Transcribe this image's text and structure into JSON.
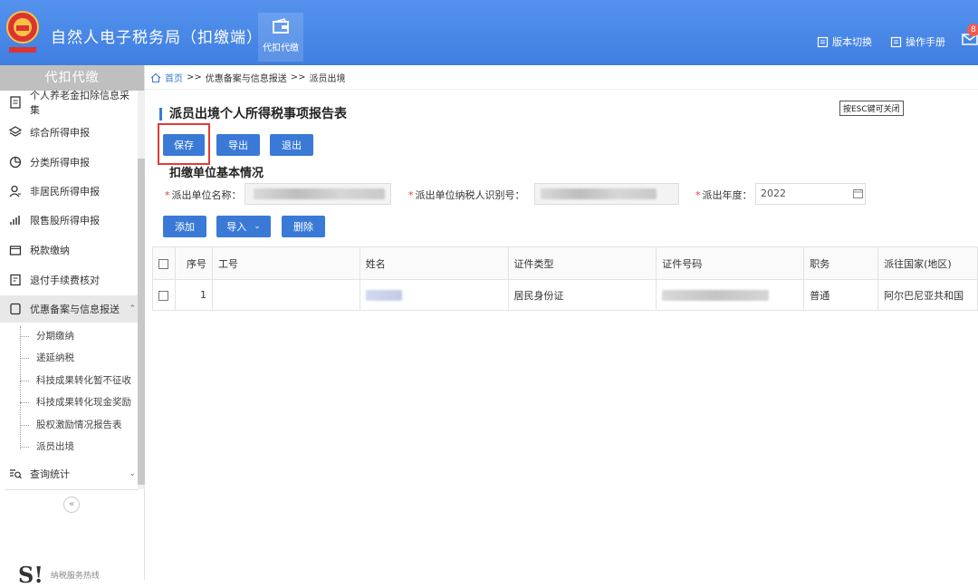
{
  "header": {
    "title": "自然人电子税务局（扣缴端）",
    "module_tab": "代扣代缴",
    "version_switch": "版本切换",
    "manual": "操作手册",
    "mail_badge": "8"
  },
  "sidebar": {
    "title": "代扣代缴",
    "items": [
      {
        "label": "个人养老金扣除信息采集",
        "icon": "document-icon"
      },
      {
        "label": "综合所得申报",
        "icon": "layers-icon"
      },
      {
        "label": "分类所得申报",
        "icon": "pie-icon"
      },
      {
        "label": "非居民所得申报",
        "icon": "person-icon"
      },
      {
        "label": "限售股所得申报",
        "icon": "bar-chart-icon"
      },
      {
        "label": "税款缴纳",
        "icon": "wallet-icon"
      },
      {
        "label": "退付手续费核对",
        "icon": "form-icon"
      },
      {
        "label": "优惠备案与信息报送",
        "icon": "file-icon"
      }
    ],
    "sub_items": [
      "分期缴纳",
      "递延纳税",
      "科技成果转化暂不征收",
      "科技成果转化现金奖励",
      "股权激励情况报告表",
      "派员出境"
    ],
    "query_item": "查询统计",
    "collapse": "«",
    "hotline": "纳税服务热线"
  },
  "breadcrumb": {
    "home": "首页",
    "sep": ">>",
    "level1": "优惠备案与信息报送",
    "level2": "派员出境"
  },
  "tooltip": "按ESC键可关闭",
  "form": {
    "title": "派员出境个人所得税事项报告表",
    "buttons": {
      "save": "保存",
      "export": "导出",
      "exit": "退出"
    },
    "section_title": "扣缴单位基本情况",
    "unit_name_label": "派出单位名称：",
    "tax_id_label": "派出单位纳税人识别号：",
    "year_label": "派出年度：",
    "year_value": "2022",
    "required_mark": "*"
  },
  "table_actions": {
    "add": "添加",
    "import": "导入",
    "delete": "删除"
  },
  "table": {
    "columns": [
      "序号",
      "工号",
      "姓名",
      "证件类型",
      "证件号码",
      "职务",
      "派往国家(地区)"
    ],
    "rows": [
      {
        "index": "1",
        "emp_no": "",
        "name": "",
        "id_type": "居民身份证",
        "id_number": "",
        "position": "普通",
        "country": "阿尔巴尼亚共和国"
      }
    ]
  },
  "colors": {
    "header": "#4a86e8",
    "button": "#3a7ad6",
    "highlight": "#e03a3a"
  }
}
